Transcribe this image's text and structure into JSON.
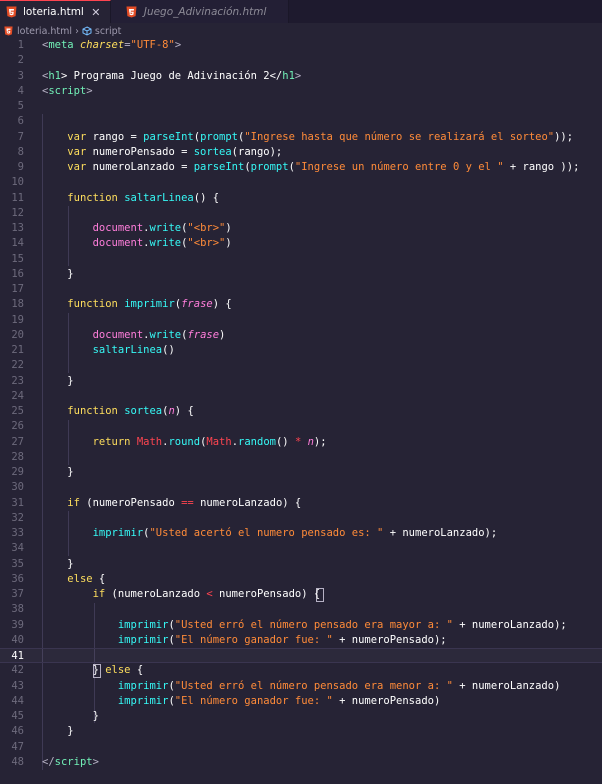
{
  "tabs": [
    {
      "label": "loteria.html",
      "active": true,
      "icon": "html5-icon"
    },
    {
      "label": "Juego_Adivinación.html",
      "active": false,
      "icon": "html5-icon"
    }
  ],
  "breadcrumb": {
    "file": "loteria.html",
    "symbol": "script"
  },
  "editor": {
    "current_line": 41,
    "lines": [
      {
        "n": "1",
        "tokens": [
          {
            "t": "<",
            "c": "punct"
          },
          {
            "t": "meta",
            "c": "tag"
          },
          {
            "t": " ",
            "c": "plain"
          },
          {
            "t": "charset",
            "c": "attr"
          },
          {
            "t": "=",
            "c": "punct"
          },
          {
            "t": "\"UTF-8\"",
            "c": "str"
          },
          {
            "t": ">",
            "c": "punct"
          }
        ]
      },
      {
        "n": "2",
        "tokens": []
      },
      {
        "n": "3",
        "tokens": [
          {
            "t": "<",
            "c": "punct"
          },
          {
            "t": "h1",
            "c": "tag"
          },
          {
            "t": "> Programa Juego de Adivinación 2</",
            "c": "plain"
          },
          {
            "t": "h1",
            "c": "tag"
          },
          {
            "t": ">",
            "c": "punct"
          }
        ]
      },
      {
        "n": "4",
        "tokens": [
          {
            "t": "<",
            "c": "punct"
          },
          {
            "t": "script",
            "c": "tag"
          },
          {
            "t": ">",
            "c": "punct"
          }
        ]
      },
      {
        "n": "5",
        "tokens": []
      },
      {
        "n": "6",
        "tokens": []
      },
      {
        "n": "7",
        "tokens": [
          {
            "t": "    ",
            "c": "plain"
          },
          {
            "t": "var",
            "c": "kw"
          },
          {
            "t": " rango = ",
            "c": "plain"
          },
          {
            "t": "parseInt",
            "c": "fn"
          },
          {
            "t": "(",
            "c": "plain"
          },
          {
            "t": "prompt",
            "c": "fn"
          },
          {
            "t": "(",
            "c": "plain"
          },
          {
            "t": "\"Ingrese hasta que número se realizará el sorteo\"",
            "c": "str"
          },
          {
            "t": "));",
            "c": "plain"
          }
        ]
      },
      {
        "n": "8",
        "tokens": [
          {
            "t": "    ",
            "c": "plain"
          },
          {
            "t": "var",
            "c": "kw"
          },
          {
            "t": " numeroPensado = ",
            "c": "plain"
          },
          {
            "t": "sortea",
            "c": "fn"
          },
          {
            "t": "(rango);",
            "c": "plain"
          }
        ]
      },
      {
        "n": "9",
        "tokens": [
          {
            "t": "    ",
            "c": "plain"
          },
          {
            "t": "var",
            "c": "kw"
          },
          {
            "t": " numeroLanzado = ",
            "c": "plain"
          },
          {
            "t": "parseInt",
            "c": "fn"
          },
          {
            "t": "(",
            "c": "plain"
          },
          {
            "t": "prompt",
            "c": "fn"
          },
          {
            "t": "(",
            "c": "plain"
          },
          {
            "t": "\"Ingrese un número entre 0 y el \"",
            "c": "str"
          },
          {
            "t": " + rango ));",
            "c": "plain"
          }
        ]
      },
      {
        "n": "10",
        "tokens": []
      },
      {
        "n": "11",
        "tokens": [
          {
            "t": "    ",
            "c": "plain"
          },
          {
            "t": "function",
            "c": "kw"
          },
          {
            "t": " ",
            "c": "plain"
          },
          {
            "t": "saltarLinea",
            "c": "fn"
          },
          {
            "t": "() {",
            "c": "plain"
          }
        ]
      },
      {
        "n": "12",
        "tokens": []
      },
      {
        "n": "13",
        "tokens": [
          {
            "t": "        ",
            "c": "plain"
          },
          {
            "t": "document",
            "c": "pink"
          },
          {
            "t": ".",
            "c": "plain"
          },
          {
            "t": "write",
            "c": "fn"
          },
          {
            "t": "(",
            "c": "plain"
          },
          {
            "t": "\"<br>\"",
            "c": "str"
          },
          {
            "t": ")",
            "c": "plain"
          }
        ]
      },
      {
        "n": "14",
        "tokens": [
          {
            "t": "        ",
            "c": "plain"
          },
          {
            "t": "document",
            "c": "pink"
          },
          {
            "t": ".",
            "c": "plain"
          },
          {
            "t": "write",
            "c": "fn"
          },
          {
            "t": "(",
            "c": "plain"
          },
          {
            "t": "\"<br>\"",
            "c": "str"
          },
          {
            "t": ")",
            "c": "plain"
          }
        ]
      },
      {
        "n": "15",
        "tokens": []
      },
      {
        "n": "16",
        "tokens": [
          {
            "t": "    }",
            "c": "plain"
          }
        ]
      },
      {
        "n": "17",
        "tokens": []
      },
      {
        "n": "18",
        "tokens": [
          {
            "t": "    ",
            "c": "plain"
          },
          {
            "t": "function",
            "c": "kw"
          },
          {
            "t": " ",
            "c": "plain"
          },
          {
            "t": "imprimir",
            "c": "fn"
          },
          {
            "t": "(",
            "c": "plain"
          },
          {
            "t": "frase",
            "c": "prm"
          },
          {
            "t": ") {",
            "c": "plain"
          }
        ]
      },
      {
        "n": "19",
        "tokens": []
      },
      {
        "n": "20",
        "tokens": [
          {
            "t": "        ",
            "c": "plain"
          },
          {
            "t": "document",
            "c": "pink"
          },
          {
            "t": ".",
            "c": "plain"
          },
          {
            "t": "write",
            "c": "fn"
          },
          {
            "t": "(",
            "c": "plain"
          },
          {
            "t": "frase",
            "c": "prm"
          },
          {
            "t": ")",
            "c": "plain"
          }
        ]
      },
      {
        "n": "21",
        "tokens": [
          {
            "t": "        ",
            "c": "plain"
          },
          {
            "t": "saltarLinea",
            "c": "fn"
          },
          {
            "t": "()",
            "c": "plain"
          }
        ]
      },
      {
        "n": "22",
        "tokens": []
      },
      {
        "n": "23",
        "tokens": [
          {
            "t": "    }",
            "c": "plain"
          }
        ]
      },
      {
        "n": "24",
        "tokens": []
      },
      {
        "n": "25",
        "tokens": [
          {
            "t": "    ",
            "c": "plain"
          },
          {
            "t": "function",
            "c": "kw"
          },
          {
            "t": " ",
            "c": "plain"
          },
          {
            "t": "sortea",
            "c": "fn"
          },
          {
            "t": "(",
            "c": "plain"
          },
          {
            "t": "n",
            "c": "prm"
          },
          {
            "t": ") {",
            "c": "plain"
          }
        ]
      },
      {
        "n": "26",
        "tokens": []
      },
      {
        "n": "27",
        "tokens": [
          {
            "t": "        ",
            "c": "plain"
          },
          {
            "t": "return",
            "c": "kw"
          },
          {
            "t": " ",
            "c": "plain"
          },
          {
            "t": "Math",
            "c": "obj"
          },
          {
            "t": ".",
            "c": "plain"
          },
          {
            "t": "round",
            "c": "fn"
          },
          {
            "t": "(",
            "c": "plain"
          },
          {
            "t": "Math",
            "c": "obj"
          },
          {
            "t": ".",
            "c": "plain"
          },
          {
            "t": "random",
            "c": "fn"
          },
          {
            "t": "() ",
            "c": "plain"
          },
          {
            "t": "*",
            "c": "obj"
          },
          {
            "t": " ",
            "c": "plain"
          },
          {
            "t": "n",
            "c": "prm"
          },
          {
            "t": ");",
            "c": "plain"
          }
        ]
      },
      {
        "n": "28",
        "tokens": []
      },
      {
        "n": "29",
        "tokens": [
          {
            "t": "    }",
            "c": "plain"
          }
        ]
      },
      {
        "n": "30",
        "tokens": []
      },
      {
        "n": "31",
        "tokens": [
          {
            "t": "    ",
            "c": "plain"
          },
          {
            "t": "if",
            "c": "kw"
          },
          {
            "t": " (numeroPensado ",
            "c": "plain"
          },
          {
            "t": "==",
            "c": "obj"
          },
          {
            "t": " numeroLanzado) {",
            "c": "plain"
          }
        ]
      },
      {
        "n": "32",
        "tokens": []
      },
      {
        "n": "33",
        "tokens": [
          {
            "t": "        ",
            "c": "plain"
          },
          {
            "t": "imprimir",
            "c": "fn"
          },
          {
            "t": "(",
            "c": "plain"
          },
          {
            "t": "\"Usted acertó el numero pensado es: \"",
            "c": "str"
          },
          {
            "t": " + numeroLanzado);",
            "c": "plain"
          }
        ]
      },
      {
        "n": "34",
        "tokens": []
      },
      {
        "n": "35",
        "tokens": [
          {
            "t": "    }",
            "c": "plain"
          }
        ]
      },
      {
        "n": "36",
        "tokens": [
          {
            "t": "    ",
            "c": "plain"
          },
          {
            "t": "else",
            "c": "kw"
          },
          {
            "t": " {",
            "c": "plain"
          }
        ]
      },
      {
        "n": "37",
        "tokens": [
          {
            "t": "        ",
            "c": "plain"
          },
          {
            "t": "if",
            "c": "kw"
          },
          {
            "t": " (numeroLanzado ",
            "c": "plain"
          },
          {
            "t": "<",
            "c": "obj"
          },
          {
            "t": " numeroPensado) {",
            "c": "plain"
          }
        ]
      },
      {
        "n": "38",
        "tokens": []
      },
      {
        "n": "39",
        "tokens": [
          {
            "t": "            ",
            "c": "plain"
          },
          {
            "t": "imprimir",
            "c": "fn"
          },
          {
            "t": "(",
            "c": "plain"
          },
          {
            "t": "\"Usted erró el número pensado era mayor a: \"",
            "c": "str"
          },
          {
            "t": " + numeroLanzado);",
            "c": "plain"
          }
        ]
      },
      {
        "n": "40",
        "tokens": [
          {
            "t": "            ",
            "c": "plain"
          },
          {
            "t": "imprimir",
            "c": "fn"
          },
          {
            "t": "(",
            "c": "plain"
          },
          {
            "t": "\"El número ganador fue: \"",
            "c": "str"
          },
          {
            "t": " + numeroPensado);",
            "c": "plain"
          }
        ]
      },
      {
        "n": "41",
        "tokens": []
      },
      {
        "n": "42",
        "tokens": [
          {
            "t": "        } ",
            "c": "plain"
          },
          {
            "t": "else",
            "c": "kw"
          },
          {
            "t": " {",
            "c": "plain"
          }
        ]
      },
      {
        "n": "43",
        "tokens": [
          {
            "t": "            ",
            "c": "plain"
          },
          {
            "t": "imprimir",
            "c": "fn"
          },
          {
            "t": "(",
            "c": "plain"
          },
          {
            "t": "\"Usted erró el número pensado era menor a: \"",
            "c": "str"
          },
          {
            "t": " + numeroLanzado)",
            "c": "plain"
          }
        ]
      },
      {
        "n": "44",
        "tokens": [
          {
            "t": "            ",
            "c": "plain"
          },
          {
            "t": "imprimir",
            "c": "fn"
          },
          {
            "t": "(",
            "c": "plain"
          },
          {
            "t": "\"El número ganador fue: \"",
            "c": "str"
          },
          {
            "t": " + numeroPensado)",
            "c": "plain"
          }
        ]
      },
      {
        "n": "45",
        "tokens": [
          {
            "t": "        }",
            "c": "plain"
          }
        ]
      },
      {
        "n": "46",
        "tokens": [
          {
            "t": "    }",
            "c": "plain"
          }
        ]
      },
      {
        "n": "47",
        "tokens": []
      },
      {
        "n": "48",
        "tokens": [
          {
            "t": "</",
            "c": "punct"
          },
          {
            "t": "script",
            "c": "tag"
          },
          {
            "t": ">",
            "c": "punct"
          }
        ]
      }
    ]
  }
}
